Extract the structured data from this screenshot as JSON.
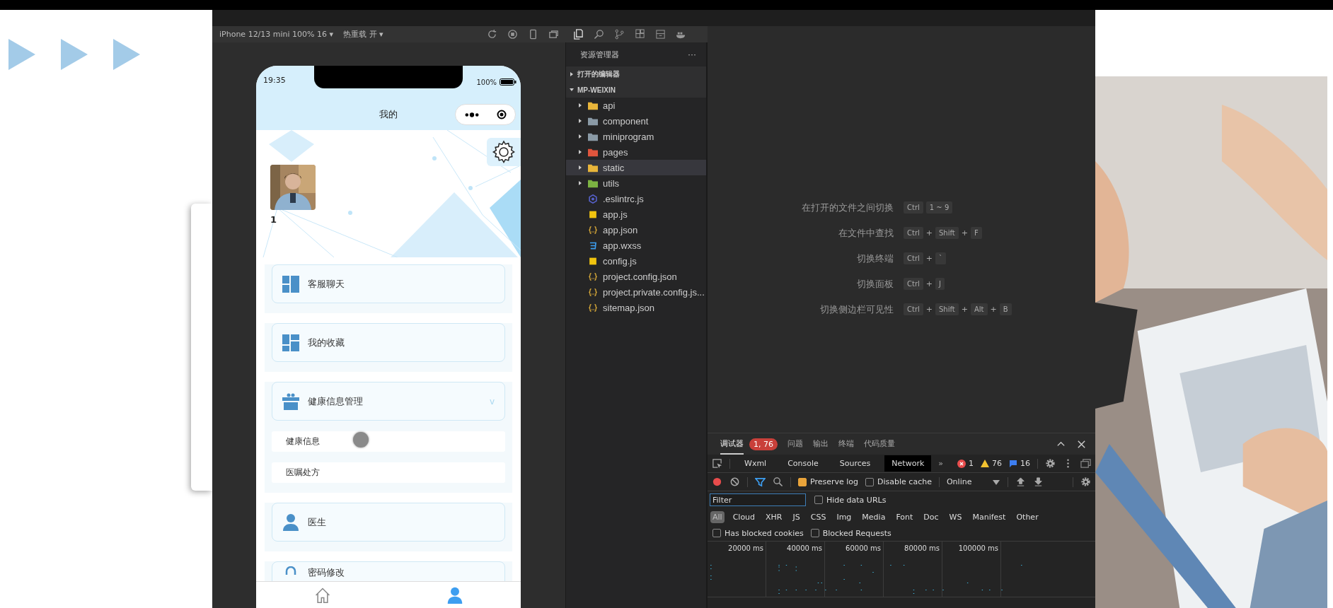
{
  "simulator_toolbar": {
    "device": "iPhone 12/13 mini 100% 16 ▾",
    "hot_reload": "热重载 开 ▾"
  },
  "phone": {
    "time": "19:35",
    "battery": "100%",
    "title": "我的",
    "user_name": "1",
    "menu": [
      {
        "kind": "link",
        "label": "客服聊天"
      },
      {
        "kind": "link",
        "label": "我的收藏"
      },
      {
        "kind": "group",
        "label": "健康信息管理",
        "caret": "v",
        "expanded": true,
        "children": [
          {
            "label": "健康信息"
          },
          {
            "label": "医嘱处方"
          }
        ]
      },
      {
        "kind": "link",
        "label": "医生"
      },
      {
        "kind": "link",
        "label": "密码修改"
      }
    ],
    "tabs": [
      {
        "selected": false
      },
      {
        "selected": true
      }
    ]
  },
  "explorer": {
    "title": "资源管理器",
    "more": "···",
    "sections": [
      {
        "label": "打开的编辑器",
        "expanded": false
      },
      {
        "label": "MP-WEIXIN",
        "expanded": true
      }
    ],
    "files": [
      {
        "name": "api",
        "kind": "folder",
        "color": "#e8b53a",
        "selected": false
      },
      {
        "name": "component",
        "kind": "folder",
        "color": "#8a9aa6",
        "selected": false
      },
      {
        "name": "miniprogram",
        "kind": "folder",
        "color": "#8a9aa6",
        "selected": false
      },
      {
        "name": "pages",
        "kind": "folder",
        "color": "#e0553d",
        "selected": false
      },
      {
        "name": "static",
        "kind": "folder",
        "color": "#e8b53a",
        "selected": true
      },
      {
        "name": "utils",
        "kind": "folder",
        "color": "#7cb342",
        "selected": false
      },
      {
        "name": ".eslintrc.js",
        "kind": "eslint",
        "selected": false
      },
      {
        "name": "app.js",
        "kind": "js",
        "selected": false
      },
      {
        "name": "app.json",
        "kind": "json",
        "selected": false
      },
      {
        "name": "app.wxss",
        "kind": "css",
        "selected": false
      },
      {
        "name": "config.js",
        "kind": "js",
        "selected": false
      },
      {
        "name": "project.config.json",
        "kind": "json",
        "selected": false
      },
      {
        "name": "project.private.config.js...",
        "kind": "json",
        "selected": false
      },
      {
        "name": "sitemap.json",
        "kind": "json",
        "selected": false
      }
    ]
  },
  "shortcuts": [
    {
      "label": "在打开的文件之间切换",
      "keys": [
        {
          "kind": "key",
          "text": "Ctrl"
        },
        {
          "kind": "key",
          "text": "1 ~ 9"
        }
      ]
    },
    {
      "label": "在文件中查找",
      "keys": [
        {
          "kind": "key",
          "text": "Ctrl"
        },
        {
          "kind": "plus",
          "text": "+"
        },
        {
          "kind": "key",
          "text": "Shift"
        },
        {
          "kind": "plus",
          "text": "+"
        },
        {
          "kind": "key",
          "text": "F"
        }
      ]
    },
    {
      "label": "切换终端",
      "keys": [
        {
          "kind": "key",
          "text": "Ctrl"
        },
        {
          "kind": "plus",
          "text": "+"
        },
        {
          "kind": "key",
          "text": "`"
        }
      ]
    },
    {
      "label": "切换面板",
      "keys": [
        {
          "kind": "key",
          "text": "Ctrl"
        },
        {
          "kind": "plus",
          "text": "+"
        },
        {
          "kind": "key",
          "text": "J"
        }
      ]
    },
    {
      "label": "切换侧边栏可见性",
      "keys": [
        {
          "kind": "key",
          "text": "Ctrl"
        },
        {
          "kind": "plus",
          "text": "+"
        },
        {
          "kind": "key",
          "text": "Shift"
        },
        {
          "kind": "plus",
          "text": "+"
        },
        {
          "kind": "key",
          "text": "Alt"
        },
        {
          "kind": "plus",
          "text": "+"
        },
        {
          "kind": "key",
          "text": "B"
        }
      ]
    }
  ],
  "devtools": {
    "panel_tabs": [
      {
        "label": "调试器",
        "selected": true,
        "badge": "1, 76"
      },
      {
        "label": "问题",
        "selected": false
      },
      {
        "label": "输出",
        "selected": false
      },
      {
        "label": "终端",
        "selected": false
      },
      {
        "label": "代码质量",
        "selected": false
      }
    ],
    "tool_tabs": [
      {
        "label": "Wxml",
        "selected": false
      },
      {
        "label": "Console",
        "selected": false
      },
      {
        "label": "Sources",
        "selected": false
      },
      {
        "label": "Network",
        "selected": true
      }
    ],
    "more_tabs": "»",
    "counts": {
      "errors": "1",
      "warnings": "76",
      "info": "16"
    },
    "preserve_log": {
      "label": "Preserve log",
      "checked": true
    },
    "disable_cache": {
      "label": "Disable cache",
      "checked": false
    },
    "throttle": "Online",
    "filter": {
      "placeholder": "Filter"
    },
    "hide_data_urls": {
      "label": "Hide data URLs",
      "checked": false
    },
    "type_filters": [
      {
        "label": "All",
        "selected": true
      },
      {
        "label": "Cloud",
        "selected": false
      },
      {
        "label": "XHR",
        "selected": false
      },
      {
        "label": "JS",
        "selected": false
      },
      {
        "label": "CSS",
        "selected": false
      },
      {
        "label": "Img",
        "selected": false
      },
      {
        "label": "Media",
        "selected": false
      },
      {
        "label": "Font",
        "selected": false
      },
      {
        "label": "Doc",
        "selected": false
      },
      {
        "label": "WS",
        "selected": false
      },
      {
        "label": "Manifest",
        "selected": false
      },
      {
        "label": "Other",
        "selected": false
      }
    ],
    "blocked_cookies": {
      "label": "Has blocked cookies",
      "checked": false
    },
    "blocked_requests": {
      "label": "Blocked Requests",
      "checked": false
    },
    "timeline_ticks": [
      "20000 ms",
      "40000 ms",
      "60000 ms",
      "80000 ms",
      "100000 ms"
    ]
  }
}
